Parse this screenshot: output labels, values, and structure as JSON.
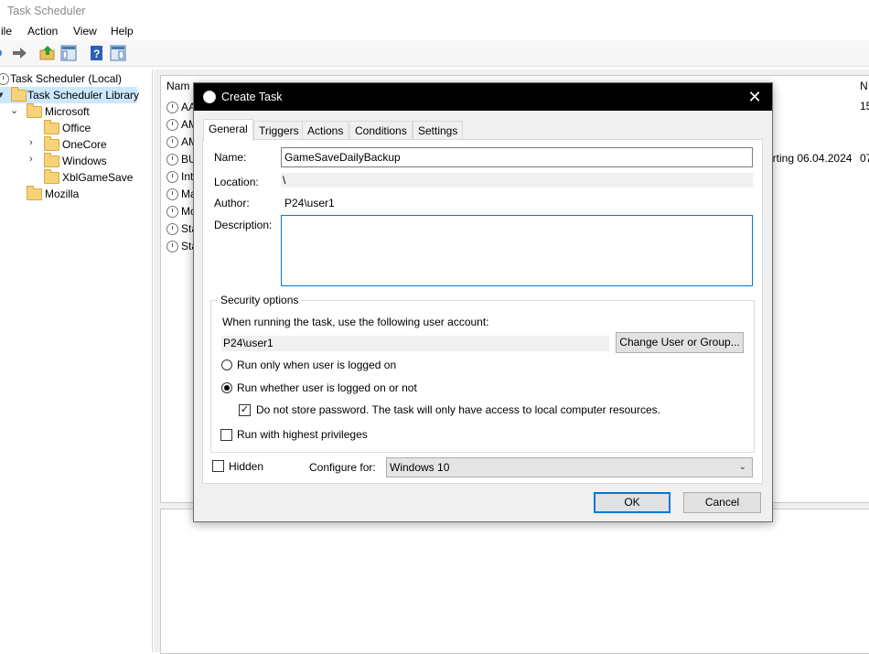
{
  "window": {
    "title": "Task Scheduler"
  },
  "menu": {
    "file": "ile",
    "action": "Action",
    "view": "View",
    "help": "Help"
  },
  "tree": {
    "root": "Task Scheduler (Local)",
    "library": "Task Scheduler Library",
    "microsoft": "Microsoft",
    "children": [
      "Office",
      "OneCore",
      "Windows",
      "XblGameSave"
    ],
    "mozilla": "Mozilla"
  },
  "list": {
    "col_name": "Nam",
    "col_right": "N",
    "rows": [
      "AA",
      "AM",
      "AM",
      "BU",
      "Int",
      "Ma",
      "Mo",
      "Sta",
      "Sta"
    ],
    "row1_right": "15",
    "row4_trigger": "arting 06.04.2024",
    "row4_right": "07"
  },
  "dialog": {
    "title": "Create Task",
    "close_icon": "close-icon",
    "tabs": [
      "General",
      "Triggers",
      "Actions",
      "Conditions",
      "Settings"
    ],
    "name_label": "Name:",
    "name_value": "GameSaveDailyBackup",
    "location_label": "Location:",
    "location_value": "\\",
    "author_label": "Author:",
    "author_value": "P24\\user1",
    "description_label": "Description:",
    "description_value": "",
    "security_legend": "Security options",
    "security_prompt": "When running the task, use the following user account:",
    "user_account": "P24\\user1",
    "change_user_button": "Change User or Group...",
    "radio_logged_on": "Run only when user is logged on",
    "radio_whether": "Run whether user is logged on or not",
    "radio_selected": "whether",
    "do_not_store": "Do not store password.  The task will only have access to local computer resources.",
    "do_not_store_checked": true,
    "highest_priv": "Run with highest privileges",
    "highest_priv_checked": false,
    "hidden_label": "Hidden",
    "hidden_checked": false,
    "configure_label": "Configure for:",
    "configure_value": "Windows 10",
    "ok_button": "OK",
    "cancel_button": "Cancel"
  }
}
